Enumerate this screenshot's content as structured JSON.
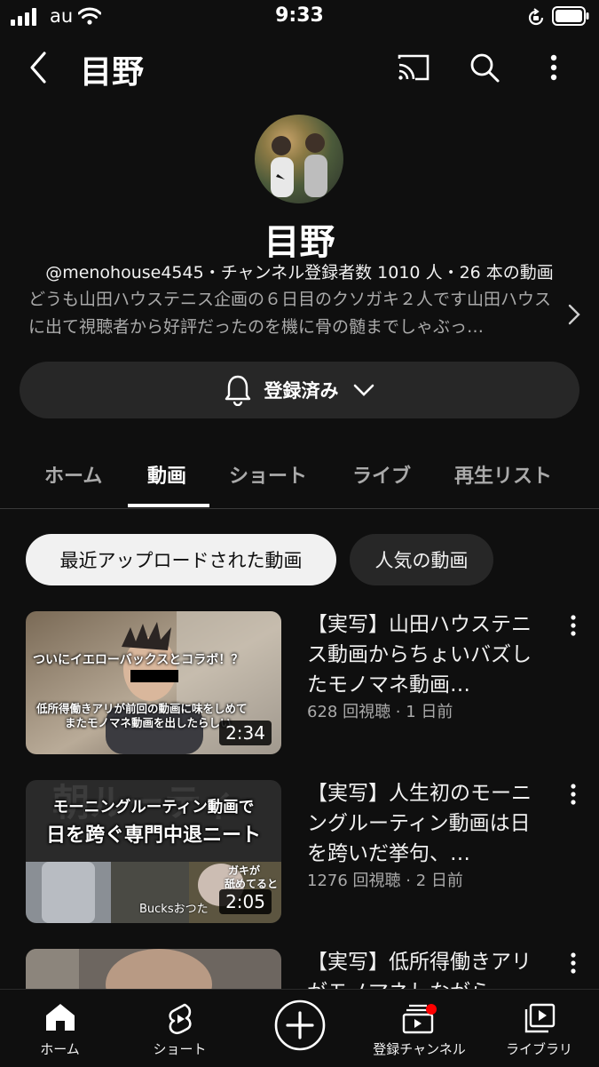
{
  "status_bar": {
    "carrier": "au",
    "time": "9:33"
  },
  "header": {
    "title": "目野"
  },
  "channel": {
    "name": "目野",
    "meta": "@menohouse4545・チャンネル登録者数 1010 人・26 本の動画",
    "description": "どうも山田ハウステニス企画の６日目のクソガキ２人です山田ハウスに出て視聴者から好評だったのを機に骨の髄までしゃぶっ…"
  },
  "subscribe": {
    "label": "登録済み"
  },
  "tabs": [
    {
      "label": "ホーム"
    },
    {
      "label": "動画"
    },
    {
      "label": "ショート"
    },
    {
      "label": "ライブ"
    },
    {
      "label": "再生リスト"
    }
  ],
  "chips": [
    {
      "label": "最近アップロードされた動画"
    },
    {
      "label": "人気の動画"
    }
  ],
  "videos": [
    {
      "title": "【実写】山田ハウステニス動画からちょいバズしたモノマネ動画…",
      "meta": "628 回視聴 · 1 日前",
      "duration": "2:34",
      "thumb_text_1": "ついにイエローバックスとコラボ！？",
      "thumb_text_2": "低所得働きアリが前回の動画に味をしめて",
      "thumb_text_3": "またモノマネ動画を出したらしい"
    },
    {
      "title": "【実写】人生初のモーニングルーティン動画は日を跨いだ挙句、…",
      "meta": "1276 回視聴 · 2 日前",
      "duration": "2:05",
      "thumb_text_1": "モーニングルーティン動画で",
      "thumb_text_2": "日を跨ぐ専門中退ニート",
      "thumb_text_3": "Bucksおつた",
      "thumb_text_4": "ガキが",
      "thumb_text_5": "舐めてると"
    },
    {
      "title": "【実写】低所得働きアリがモノマネしながら"
    }
  ],
  "bottom_nav": [
    {
      "label": "ホーム"
    },
    {
      "label": "ショート"
    },
    {
      "label": ""
    },
    {
      "label": "登録チャンネル"
    },
    {
      "label": "ライブラリ"
    }
  ],
  "colors": {
    "background": "#0f0f0f",
    "chip_selected": "#f1f1f1",
    "chip": "#272727",
    "notification_dot": "#ff0000",
    "secondary_text": "#aaaaaa"
  }
}
